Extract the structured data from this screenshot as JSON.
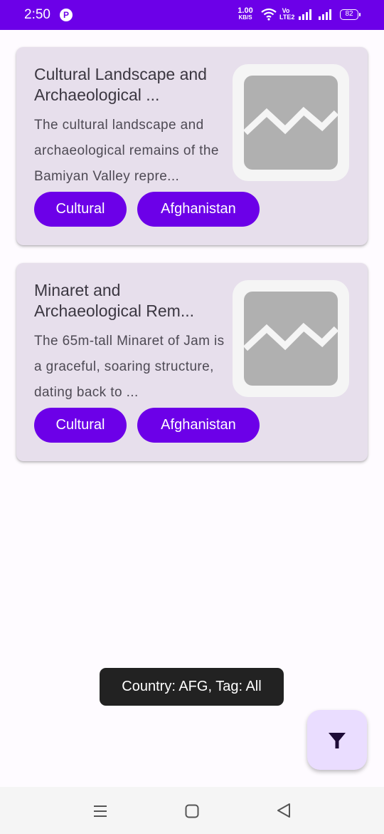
{
  "status_bar": {
    "time": "2:50",
    "app_icon": "app-notification-icon",
    "net_speed_value": "1.00",
    "net_speed_unit": "KB/S",
    "volte_top": "Vo",
    "volte_bottom": "LTE2",
    "battery": "82",
    "icons": [
      "wifi-icon",
      "signal-icon",
      "signal-icon",
      "battery-icon"
    ],
    "background": "#6c00e8"
  },
  "sites": [
    {
      "title": "Cultural Landscape and Archaeological ...",
      "description": "The cultural landscape and archaeological remains of the Bamiyan Valley repre...",
      "tag": "Cultural",
      "country": "Afghanistan",
      "thumbnail_icon": "image-placeholder-icon"
    },
    {
      "title": "Minaret and Archaeological Rem...",
      "description": "The 65m-tall Minaret of Jam is a graceful, soaring structure, dating back to ...",
      "tag": "Cultural",
      "country": "Afghanistan",
      "thumbnail_icon": "image-placeholder-icon"
    }
  ],
  "toast": {
    "text": "Country: AFG, Tag: All"
  },
  "fab": {
    "icon": "filter-icon"
  },
  "nav_bar": {
    "icons": [
      "menu-icon",
      "home-icon",
      "back-icon"
    ]
  },
  "colors": {
    "accent": "#6c00e8",
    "card_background": "#e7dfec",
    "fab_background": "#eaddff",
    "toast_background": "#222222"
  }
}
